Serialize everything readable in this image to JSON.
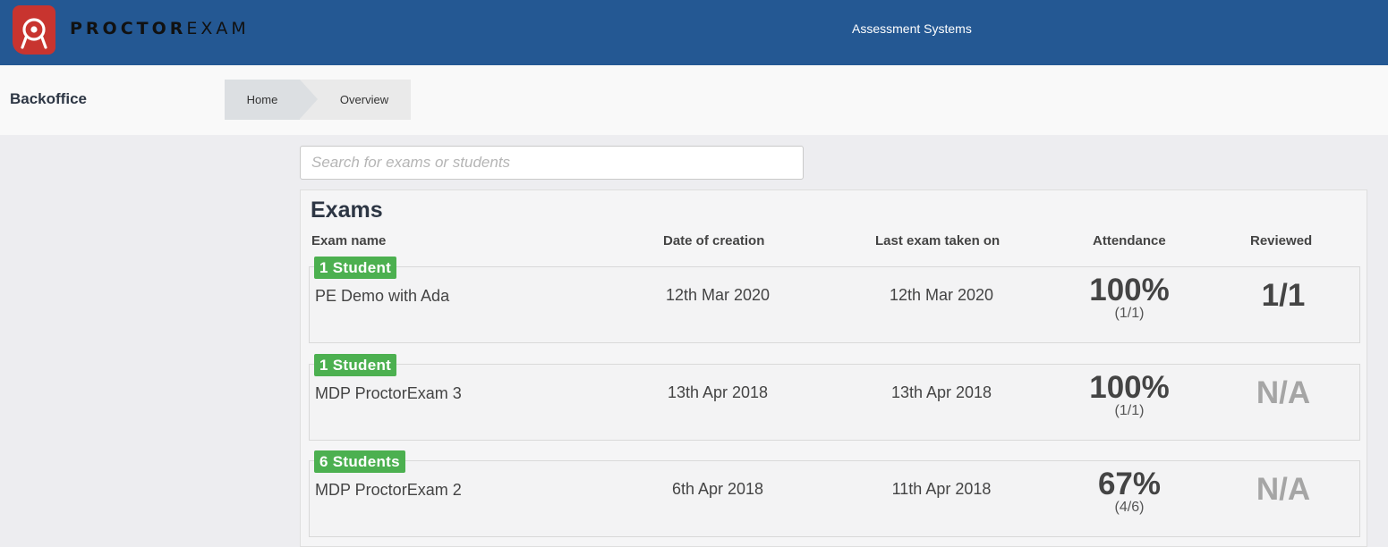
{
  "header": {
    "logo_bold": "PROCTOR",
    "logo_light": "EXAM",
    "organization": "Assessment Systems",
    "brand_color": "#245893",
    "logo_color": "#c8342f"
  },
  "subheader": {
    "section_title": "Backoffice",
    "breadcrumbs": [
      "Home",
      "Overview"
    ]
  },
  "search": {
    "placeholder": "Search for exams or students",
    "value": ""
  },
  "exams": {
    "title": "Exams",
    "columns": [
      "Exam name",
      "Date of creation",
      "Last exam taken on",
      "Attendance",
      "Reviewed"
    ],
    "badge_color": "#4cb050",
    "rows": [
      {
        "students": "1 Student",
        "name": "PE Demo with Ada",
        "created": "12th Mar 2020",
        "last_taken": "12th Mar 2020",
        "attendance_pct": "100%",
        "attendance_count": "(1/1)",
        "reviewed": "1/1"
      },
      {
        "students": "1 Student",
        "name": "MDP ProctorExam 3",
        "created": "13th Apr 2018",
        "last_taken": "13th Apr 2018",
        "attendance_pct": "100%",
        "attendance_count": "(1/1)",
        "reviewed": "N/A"
      },
      {
        "students": "6 Students",
        "name": "MDP ProctorExam 2",
        "created": "6th Apr 2018",
        "last_taken": "11th Apr 2018",
        "attendance_pct": "67%",
        "attendance_count": "(4/6)",
        "reviewed": "N/A"
      }
    ]
  }
}
